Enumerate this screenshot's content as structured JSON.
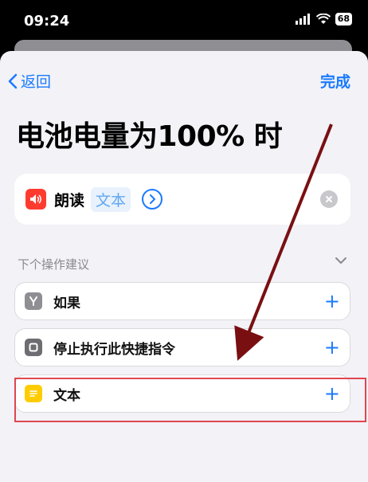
{
  "status_bar": {
    "time": "09:24",
    "battery": "68"
  },
  "nav": {
    "back_label": "返回",
    "done_label": "完成"
  },
  "page_title": "电池电量为100% 时",
  "action": {
    "label": "朗读",
    "param": "文本"
  },
  "suggestions": {
    "header": "下个操作建议",
    "items": [
      {
        "label": "如果",
        "icon": "if-icon"
      },
      {
        "label": "停止执行此快捷指令",
        "icon": "stop-icon"
      },
      {
        "label": "文本",
        "icon": "text-doc-icon"
      }
    ]
  },
  "colors": {
    "accent": "#1a7aff",
    "speaker": "#ff3b30",
    "text_icon": "#ffcc00",
    "annotation": "#7a0f12",
    "highlight": "#e0464f"
  }
}
